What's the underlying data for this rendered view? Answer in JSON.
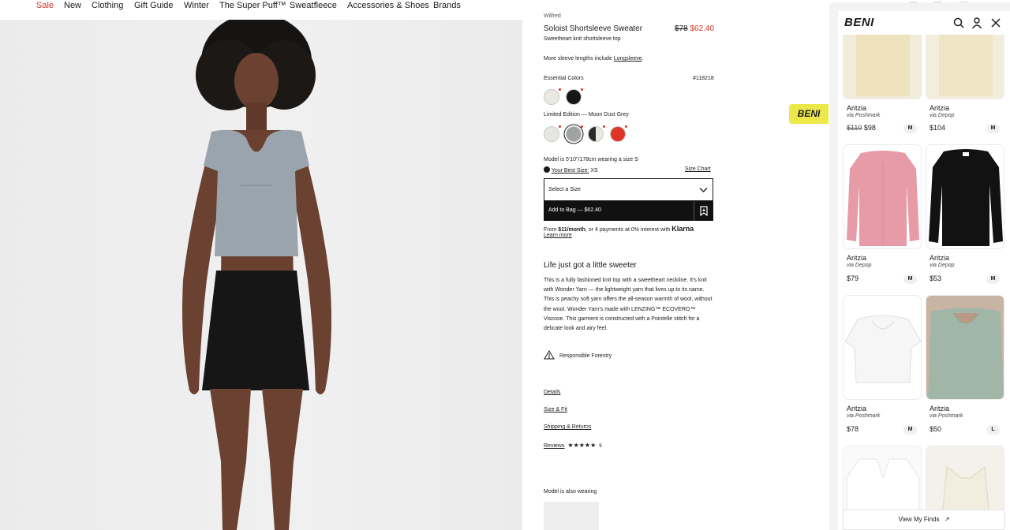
{
  "nav": [
    "Sale",
    "New",
    "Clothing",
    "Gift Guide",
    "Winter",
    "The Super Puff™",
    "Sweatfleece",
    "Accessories & Shoes",
    "Brands"
  ],
  "product": {
    "brand": "Wilfred",
    "name": "Soloist Shortsleeve Sweater",
    "orig_price": "$78",
    "sale_price": "$62.40",
    "subtitle": "Sweetheart knit shortsleeve top",
    "more_prefix": "More sleeve lengths include",
    "more_link": "Longsleeve",
    "more_suffix": ".",
    "essential_label": "Essential Colors",
    "product_id": "#118218",
    "limited_label": "Limited Edition — Moon Dust Grey",
    "model_info": "Model is 5'10\"/178cm wearing a size S",
    "best_size_label": "Your Best Size:",
    "best_size_value": "XS",
    "size_chart": "Size Chart",
    "select_size": "Select a Size",
    "add_to_bag": "Add to Bag — $62.40",
    "klarna_from": "From",
    "klarna_amount": "$11/month",
    "klarna_rest": ", or 4 payments at 0% interest with",
    "klarna_brand": "Klarna",
    "learn_more": "Learn more",
    "headline": "Life just got a little sweeter",
    "description": "This is a fully fashioned knit top with a sweetheart neckline. It's knit with Wonder Yarn — the lightweight yarn that lives up to its name. This is peachy soft yarn offers the all-season warmth of wool, without the wool. Wonder Yarn's made with LENZING™ ECOVERO™ Viscose. This garment is constructed with a Pointelle stitch for a delicate look and airy feel.",
    "forestry": "Responsible Forestry",
    "details": "Details",
    "size_fit": "Size & Fit",
    "shipping": "Shipping & Returns",
    "reviews": "Reviews",
    "stars": "★★★★★",
    "review_count": "9",
    "also_wearing": "Model is also wearing"
  },
  "swatches": {
    "essential": [
      "#e9e8e1",
      "#161616"
    ],
    "limited": [
      "#e6e6e3",
      "#a0a3a3",
      "#2a2a2a",
      "#df3526"
    ]
  },
  "beni": {
    "logo": "BENI",
    "tab_logo": "BENI",
    "view_finds": "View My Finds",
    "items": [
      {
        "brand": "Aritzia",
        "via": "via Poshmark",
        "price_old": "$110",
        "price": "$98",
        "size": "M"
      },
      {
        "brand": "Aritzia",
        "via": "via Depop",
        "price_old": "",
        "price": "$104",
        "size": "M"
      },
      {
        "brand": "Aritzia",
        "via": "via Depop",
        "price_old": "",
        "price": "$79",
        "size": "M"
      },
      {
        "brand": "Aritzia",
        "via": "via Depop",
        "price_old": "",
        "price": "$53",
        "size": "M"
      },
      {
        "brand": "Aritzia",
        "via": "via Poshmark",
        "price_old": "",
        "price": "$78",
        "size": "M"
      },
      {
        "brand": "Aritzia",
        "via": "via Poshmark",
        "price_old": "",
        "price": "$50",
        "size": "L"
      }
    ]
  },
  "colors": {
    "sale_red": "#d2372a",
    "beni_yellow": "#ede84a",
    "bag_black": "#111111"
  }
}
